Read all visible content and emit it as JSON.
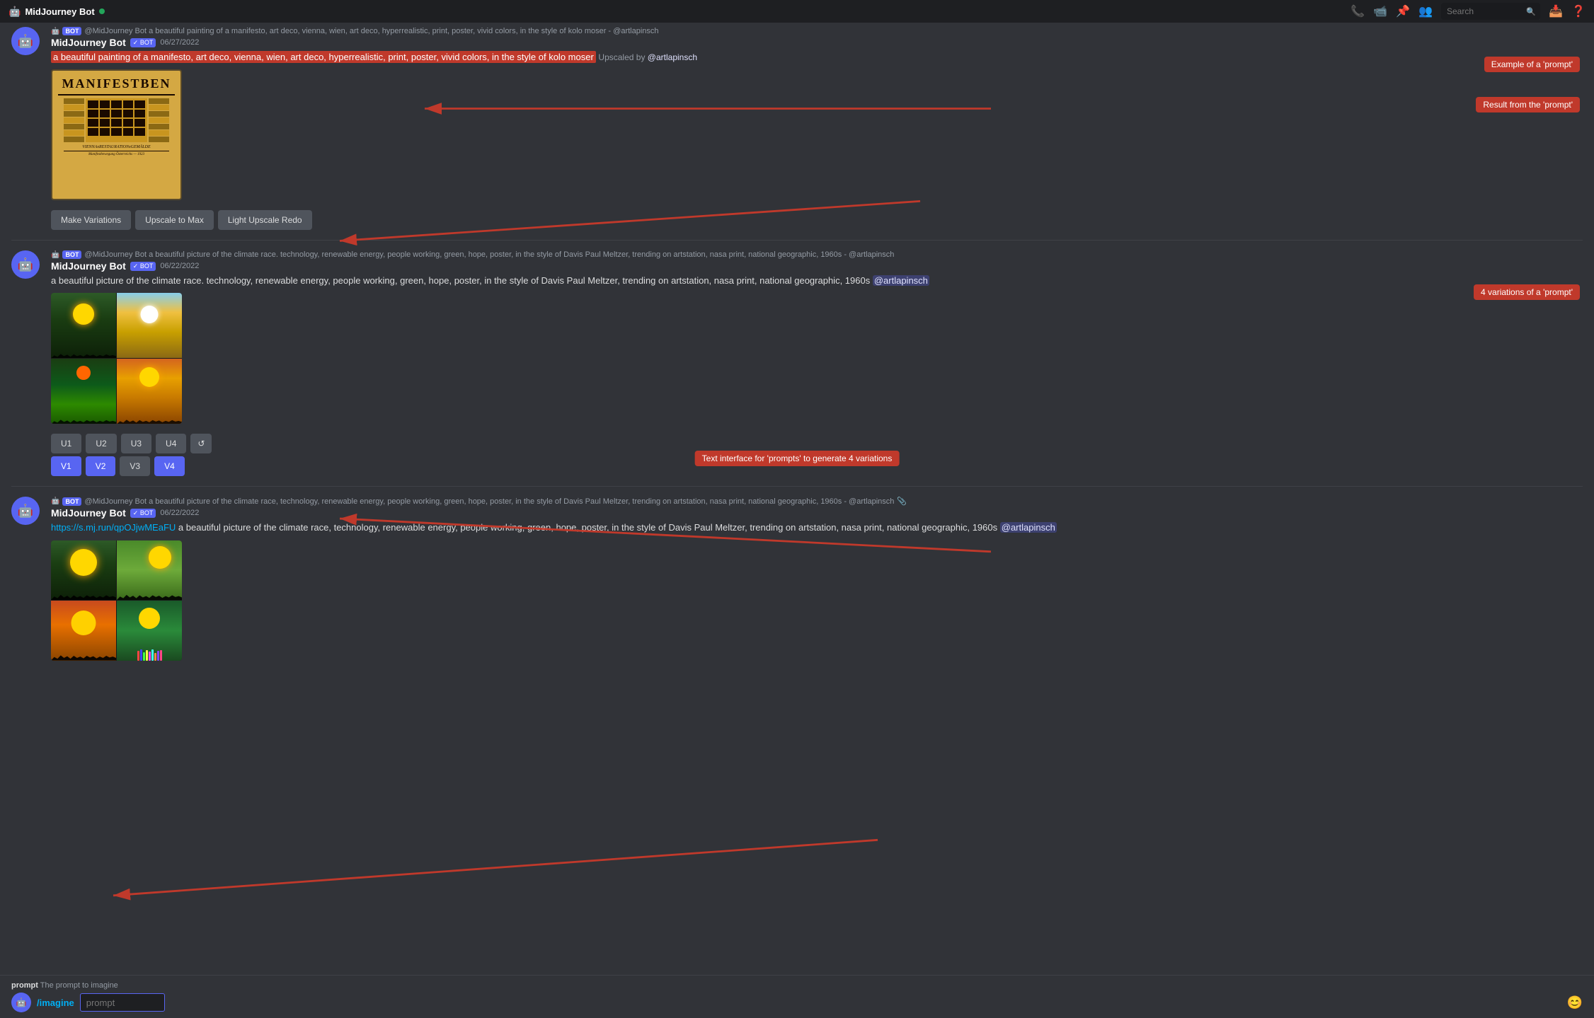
{
  "titlebar": {
    "title": "MidJourney Bot",
    "online": true,
    "search_placeholder": "Search",
    "icons": [
      "phone",
      "video",
      "pin",
      "members",
      "search",
      "inbox",
      "help"
    ]
  },
  "messages": [
    {
      "id": "msg1",
      "avatar": "M",
      "username": "MidJourney Bot",
      "verified": true,
      "bot": true,
      "timestamp": "06/27/2022",
      "command_header": "@MidJourney Bot a beautiful painting of a manifesto, art deco, vienna, wien, art deco, hyperrealistic, print, poster, vivid colors, in the style of kolo moser - @artlapinsch",
      "prompt": "a beautiful painting of a manifesto, art deco, vienna, wien, art deco, hyperrealistic, print, poster, vivid colors, in the style of kolo moser",
      "upscaled_by": "@artlapinsch",
      "image_type": "poster",
      "buttons": [
        "Make Variations",
        "Upscale to Max",
        "Light Upscale Redo"
      ]
    },
    {
      "id": "msg2",
      "avatar": "M",
      "username": "MidJourney Bot",
      "verified": true,
      "bot": true,
      "timestamp": "06/22/2022",
      "command_header": "@MidJourney Bot a beautiful picture of the climate race. technology, renewable energy, people working, green, hope, poster, in the style of Davis Paul Meltzer, trending on artstation, nasa print, national geographic, 1960s - @artlapinsch",
      "prompt": "a beautiful picture of the climate race. technology, renewable energy, people working, green, hope, poster, in the style of Davis Paul Meltzer, trending on artstation, nasa print, national geographic, 1960s",
      "mention": "@artlapinsch",
      "image_type": "grid",
      "buttons_u": [
        "U1",
        "U2",
        "U3",
        "U4"
      ],
      "buttons_v": [
        "V1",
        "V2",
        "V3",
        "V4"
      ],
      "button_refresh": "↺"
    },
    {
      "id": "msg3",
      "avatar": "M",
      "username": "MidJourney Bot",
      "verified": true,
      "bot": true,
      "timestamp": "06/22/2022",
      "command_header": "@MidJourney Bot a beautiful picture of the climate race, technology, renewable energy, people working, green, hope, poster, in the style of Davis Paul Meltzer, trending on artstation, nasa print, national geographic, 1960s - @artlapinsch",
      "link": "https://s.mj.run/qpOJjwMEaFU",
      "prompt": "a beautiful picture of the climate race, technology, renewable energy, people working, green, hope, poster, in the style of Davis Paul Meltzer, trending on artstation, nasa print, national geographic, 1960s",
      "mention": "@artlapinsch",
      "image_type": "climate_large"
    }
  ],
  "annotations": [
    {
      "id": "ann1",
      "label": "Example of a 'prompt'"
    },
    {
      "id": "ann2",
      "label": "Result from the 'prompt'"
    },
    {
      "id": "ann3",
      "label": "4 variations of a 'prompt'"
    },
    {
      "id": "ann4",
      "label": "Text interface for 'prompts' to generate 4 variations"
    }
  ],
  "prompt_bar": {
    "hint_label": "prompt",
    "hint_text": "The prompt to imagine",
    "command": "/imagine",
    "placeholder": "prompt",
    "emoji": "😊"
  }
}
